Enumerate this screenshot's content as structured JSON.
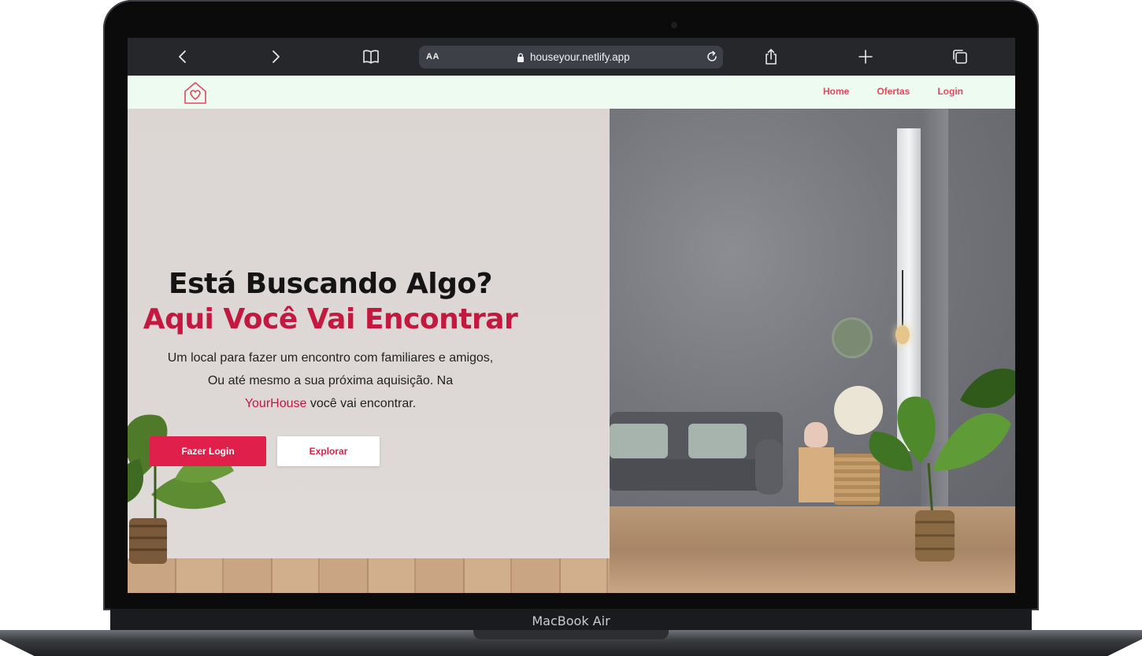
{
  "device": {
    "label": "MacBook Air"
  },
  "browser": {
    "text_size_label": "AA",
    "url": "houseyour.netlify.app",
    "icons": {
      "back": "chevron-left-icon",
      "forward": "chevron-right-icon",
      "bookmarks": "book-icon",
      "lock": "lock-icon",
      "reload": "reload-icon",
      "share": "share-icon",
      "new_tab": "plus-icon",
      "tabs": "tabs-icon"
    }
  },
  "site": {
    "logo": "house-heart-icon",
    "nav": [
      {
        "label": "Home"
      },
      {
        "label": "Ofertas"
      },
      {
        "label": "Login"
      }
    ],
    "colors": {
      "accent": "#e0204b",
      "accent_dark": "#c4183e",
      "nav_text": "#e5485f",
      "header_bg": "#edfbf1"
    }
  },
  "hero": {
    "title_line1": "Está Buscando Algo?",
    "title_line2": "Aqui Você Vai Encontrar",
    "description_part1": "Um local para fazer um encontro com familiares e amigos, Ou até mesmo a sua próxima aquisição. Na",
    "brand_name": "YourHouse",
    "description_part2": "você vai encontrar.",
    "primary_button": "Fazer Login",
    "secondary_button": "Explorar"
  }
}
